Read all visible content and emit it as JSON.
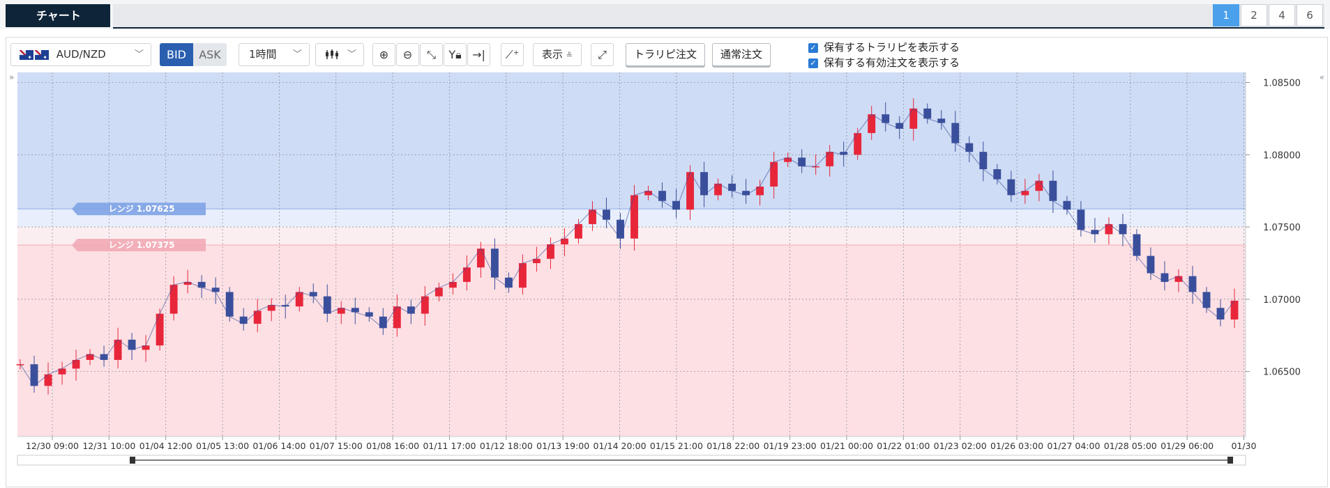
{
  "tabs": {
    "main_label": "チャート",
    "pages": [
      "1",
      "2",
      "4",
      "6"
    ],
    "active_page": "1"
  },
  "toolbar": {
    "symbol": "AUD/NZD",
    "bid_label": "BID",
    "ask_label": "ASK",
    "interval": "1時間",
    "display_label": "表示",
    "trap_order_label": "トラリピ注文",
    "normal_order_label": "通常注文",
    "check1_label": "保有するトラリピを表示する",
    "check2_label": "保有する有効注文を表示する",
    "icons": [
      "candlestick-icon",
      "zoom-in-icon",
      "zoom-out-icon",
      "fit-icon",
      "y-lock-icon",
      "jump-end-icon",
      "add-indicator-icon",
      "fullscreen-icon"
    ]
  },
  "colors": {
    "up": "#e8263a",
    "down": "#3a4f9c",
    "buy_zone": "#cfdcf5",
    "sell_zone": "#fde0e4",
    "range_label": "#7fa3e6"
  },
  "range_labels": [
    "レンジ 1.07625",
    "レンジ 1.07375"
  ],
  "chart_data": {
    "type": "line",
    "description_series": "AUD/NZD 1-hour BID candles (close values, approx.)",
    "ylim": [
      1.0605,
      1.0857
    ],
    "yticks": [
      1.065,
      1.07,
      1.075,
      1.08,
      1.085
    ],
    "ytick_labels": [
      "1.06500",
      "1.07000",
      "1.07500",
      "1.08000",
      "1.08500"
    ],
    "x_labels": [
      "12/30 09:00",
      "12/31 10:00",
      "01/04 12:00",
      "01/05 13:00",
      "01/06 14:00",
      "01/07 15:00",
      "01/08 16:00",
      "01/11 17:00",
      "01/12 18:00",
      "01/13 19:00",
      "01/14 20:00",
      "01/15 21:00",
      "01/18 22:00",
      "01/19 23:00",
      "01/21 00:00",
      "01/22 01:00",
      "01/23 02:00",
      "01/26 03:00",
      "01/27 04:00",
      "01/28 05:00",
      "01/29 06:00",
      "01/30"
    ],
    "zones": {
      "buy_zone_low": 1.07625,
      "sell_zone_high": 1.07375,
      "range_band": [
        1.075,
        1.07625
      ]
    },
    "x": [
      0,
      5,
      10,
      15,
      20,
      25,
      30,
      35,
      40,
      45,
      50,
      55,
      60,
      65,
      70,
      75,
      80,
      85,
      90,
      95,
      100,
      105,
      110,
      115,
      120,
      125,
      130,
      135,
      140,
      145,
      150,
      155,
      160,
      165,
      170,
      175,
      180,
      185,
      190,
      195,
      200,
      205,
      210,
      215,
      220,
      225,
      230,
      235,
      240,
      245,
      250,
      255,
      260,
      265,
      270,
      275,
      280,
      285,
      290,
      295,
      300,
      305,
      310,
      315,
      320,
      325,
      330,
      335,
      340,
      345,
      350,
      355,
      360,
      365,
      370,
      375,
      380,
      385,
      390,
      395,
      400,
      405,
      410,
      415,
      420,
      425,
      430,
      435
    ],
    "y": [
      1.0655,
      1.064,
      1.0648,
      1.0652,
      1.0658,
      1.0662,
      1.0658,
      1.0672,
      1.0665,
      1.0668,
      1.069,
      1.071,
      1.0712,
      1.0708,
      1.0705,
      1.0688,
      1.0683,
      1.0692,
      1.0696,
      1.0695,
      1.0705,
      1.0702,
      1.069,
      1.0694,
      1.0691,
      1.0688,
      1.068,
      1.0695,
      1.069,
      1.0702,
      1.0708,
      1.0712,
      1.0722,
      1.0735,
      1.0715,
      1.0708,
      1.0725,
      1.0728,
      1.0738,
      1.0742,
      1.0752,
      1.0762,
      1.0755,
      1.0742,
      1.0772,
      1.0775,
      1.0768,
      1.0762,
      1.0788,
      1.0772,
      1.078,
      1.0775,
      1.0772,
      1.0778,
      1.0795,
      1.0798,
      1.0792,
      1.0792,
      1.0802,
      1.08,
      1.0815,
      1.0828,
      1.0822,
      1.0818,
      1.0832,
      1.0825,
      1.0822,
      1.0808,
      1.0802,
      1.079,
      1.0783,
      1.0772,
      1.0775,
      1.0782,
      1.0768,
      1.0762,
      1.0748,
      1.0745,
      1.0752,
      1.0745,
      1.073,
      1.0718,
      1.0712,
      1.0716,
      1.0705,
      1.0694,
      1.0686,
      1.0699
    ]
  }
}
